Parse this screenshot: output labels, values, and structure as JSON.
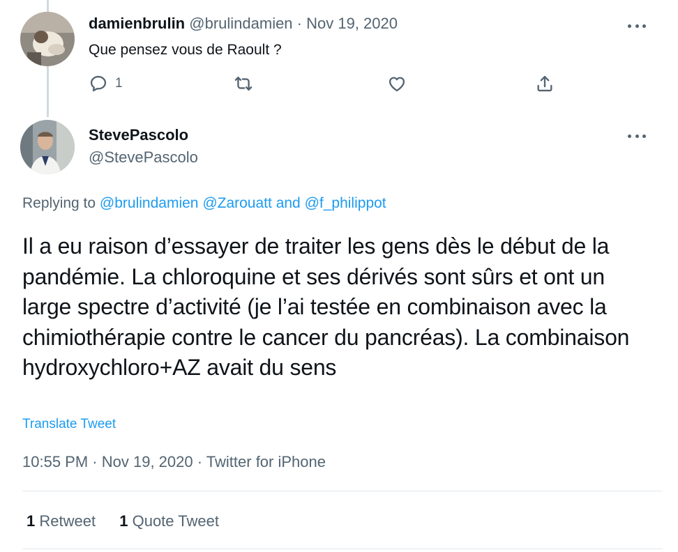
{
  "reply_tweet": {
    "display_name": "damienbrulin",
    "handle": "@brulindamien",
    "separator": "·",
    "date": "Nov 19, 2020",
    "text": "Que pensez vous de Raoult ?",
    "reply_count": "1"
  },
  "main_tweet": {
    "display_name": "StevePascolo",
    "handle": "@StevePascolo",
    "replying_prefix": "Replying to",
    "replying_users": [
      "@brulindamien",
      "@Zarouatt"
    ],
    "replying_and": "and",
    "replying_last": "@f_philippot",
    "text": "Il a eu raison d’essayer de traiter les gens dès le début de la pandémie. La chloroquine et ses dérivés sont sûrs et ont un large spectre d’activité (je l’ai testée en combinaison avec la chimiothérapie contre le cancer du pancréas). La combinaison hydroxychloro+AZ avait du sens",
    "translate_label": "Translate Tweet",
    "time": "10:55 PM",
    "date": "Nov 19, 2020",
    "source": "Twitter for iPhone",
    "separator": "·",
    "retweet_count": "1",
    "retweet_label": "Retweet",
    "quote_count": "1",
    "quote_label": "Quote Tweet"
  },
  "icons": {
    "reply": "reply-icon",
    "retweet": "retweet-icon",
    "like": "heart-icon",
    "share": "share-icon",
    "more": "more-icon"
  },
  "colors": {
    "text": "#0f1419",
    "muted": "#536471",
    "link": "#1d9bf0",
    "divider": "#e1e8ed",
    "thread_line": "#cfd9de"
  }
}
